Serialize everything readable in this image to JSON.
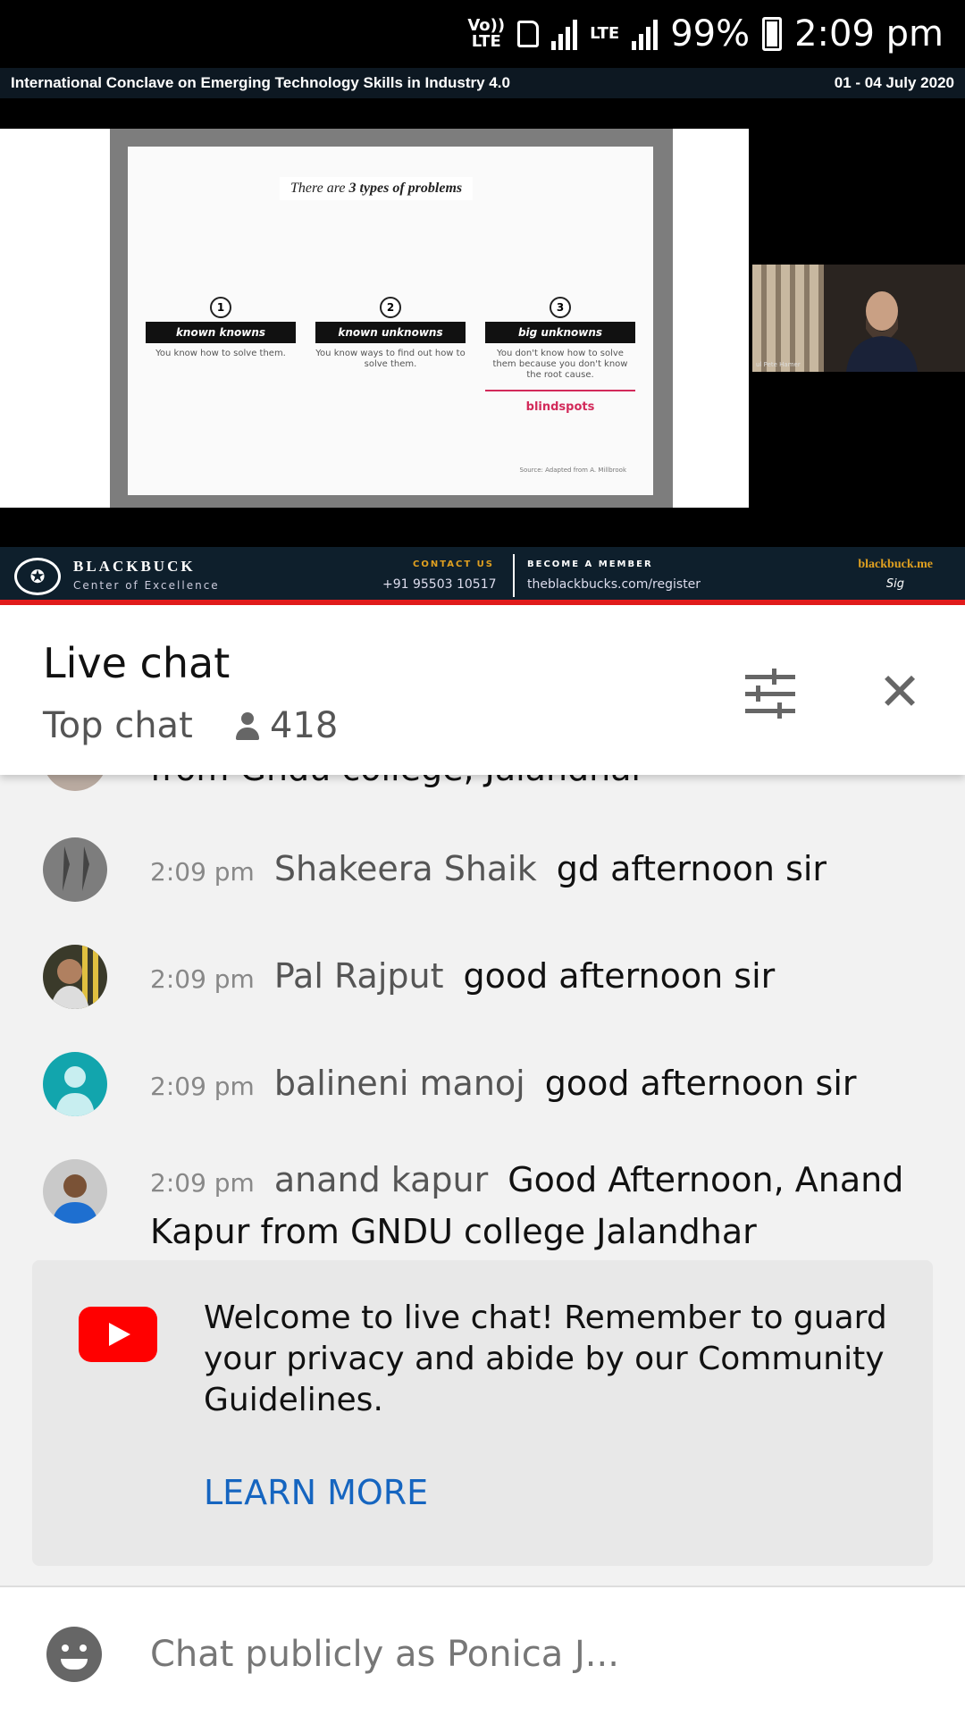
{
  "status_bar": {
    "volte": "Vo))",
    "lte_label": "LTE",
    "lte2": "LTE",
    "battery": "99%",
    "time": "2:09 pm"
  },
  "video": {
    "banner_left": "International Conclave on Emerging Technology Skills in Industry 4.0",
    "banner_right": "01 - 04 July 2020",
    "slide": {
      "title_prefix": "There are ",
      "title_bold": "3 types of problems",
      "columns": [
        {
          "num": "1",
          "head": "known knowns",
          "body": "You know how to solve them."
        },
        {
          "num": "2",
          "head": "known unknowns",
          "body": "You know ways to find out how to solve them."
        },
        {
          "num": "3",
          "head": "big unknowns",
          "body": "You don't know how to solve them because you don't know the root cause.",
          "extra": "blindspots"
        }
      ],
      "source": "Source: Adapted from A. Millbrook"
    },
    "speaker_name": "ul Pete Hamer",
    "footer": {
      "brand": "BLACKBUCK",
      "brand_sub": "Center of Excellence",
      "contact_label": "CONTACT US",
      "contact": "+91 95503 10517",
      "member_label": "BECOME A MEMBER",
      "member": "theblackbucks.com/register",
      "site": "blackbuck.me",
      "sign": "Sig"
    }
  },
  "chat_header": {
    "title": "Live chat",
    "mode": "Top chat",
    "viewers": "418"
  },
  "messages": [
    {
      "time": "",
      "author": "",
      "text": "from Gndu college, Jalandhar"
    },
    {
      "time": "2:09 pm",
      "author": "Shakeera Shaik",
      "text": "gd afternoon sir"
    },
    {
      "time": "2:09 pm",
      "author": "Pal Rajput",
      "text": "good afternoon sir"
    },
    {
      "time": "2:09 pm",
      "author": "balineni manoj",
      "text": "good afternoon sir"
    },
    {
      "time": "2:09 pm",
      "author": "anand kapur",
      "text": "Good Afternoon, Anand Kapur from GNDU college Jalandhar"
    }
  ],
  "welcome": {
    "text": "Welcome to live chat! Remember to guard your privacy and abide by our Community Guidelines.",
    "learn_more": "LEARN MORE"
  },
  "input": {
    "placeholder": "Chat publicly as Ponica J..."
  },
  "colors": {
    "youtube_red": "#ff0000",
    "link_blue": "#1565c0",
    "footer_red": "#e31c1c"
  }
}
